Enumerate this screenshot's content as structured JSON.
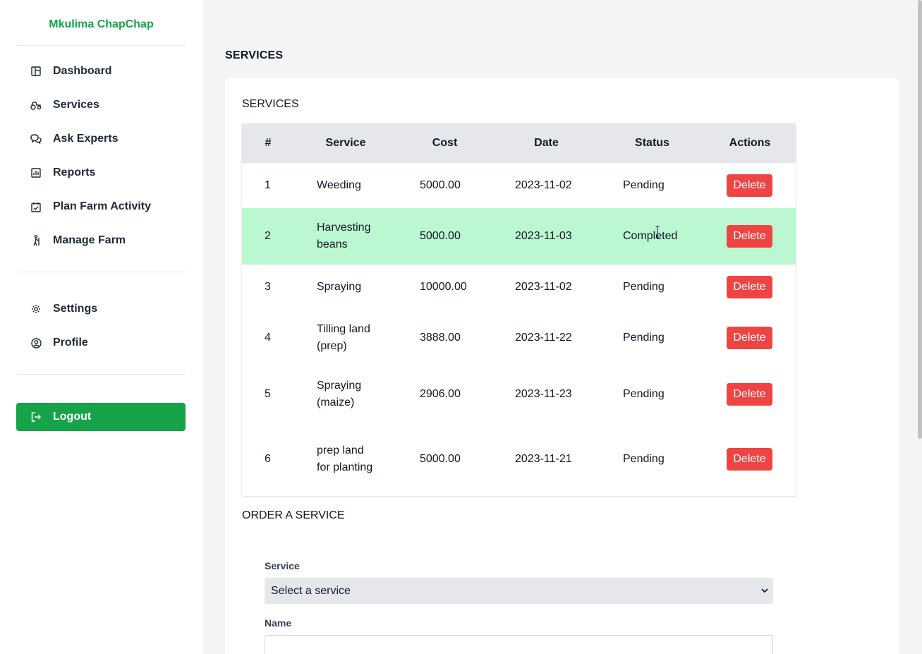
{
  "brand": "Mkulima ChapChap",
  "sidebar": {
    "items": [
      {
        "label": "Dashboard",
        "icon": "dashboard-icon"
      },
      {
        "label": "Services",
        "icon": "tractor-icon"
      },
      {
        "label": "Ask Experts",
        "icon": "chat-icon"
      },
      {
        "label": "Reports",
        "icon": "chart-icon"
      },
      {
        "label": "Plan Farm Activity",
        "icon": "calendar-check-icon"
      },
      {
        "label": "Manage Farm",
        "icon": "farmer-icon"
      }
    ],
    "secondary": [
      {
        "label": "Settings",
        "icon": "gear-icon"
      },
      {
        "label": "Profile",
        "icon": "user-circle-icon"
      }
    ],
    "logout_label": "Logout"
  },
  "page_title": "SERVICES",
  "card_title": "SERVICES",
  "table": {
    "headers": [
      "#",
      "Service",
      "Cost",
      "Date",
      "Status",
      "Actions"
    ],
    "rows": [
      {
        "num": "1",
        "service": "Weeding",
        "cost": "5000.00",
        "date": "2023-11-02",
        "status": "Pending",
        "action": "Delete"
      },
      {
        "num": "2",
        "service": "Harvesting beans",
        "cost": "5000.00",
        "date": "2023-11-03",
        "status": "Completed",
        "action": "Delete"
      },
      {
        "num": "3",
        "service": "Spraying",
        "cost": "10000.00",
        "date": "2023-11-02",
        "status": "Pending",
        "action": "Delete"
      },
      {
        "num": "4",
        "service": "Tilling land (prep)",
        "cost": "3888.00",
        "date": "2023-11-22",
        "status": "Pending",
        "action": "Delete"
      },
      {
        "num": "5",
        "service": "Spraying (maize)",
        "cost": "2906.00",
        "date": "2023-11-23",
        "status": "Pending",
        "action": "Delete"
      },
      {
        "num": "6",
        "service": "prep land for planting",
        "cost": "5000.00",
        "date": "2023-11-21",
        "status": "Pending",
        "action": "Delete"
      }
    ]
  },
  "order": {
    "title": "ORDER A SERVICE",
    "service_label": "Service",
    "service_selected": "Select a service",
    "name_label": "Name",
    "name_value": ""
  },
  "colors": {
    "brand": "#16a34a",
    "highlight_row": "#bbf7d0",
    "delete": "#ef4444"
  }
}
